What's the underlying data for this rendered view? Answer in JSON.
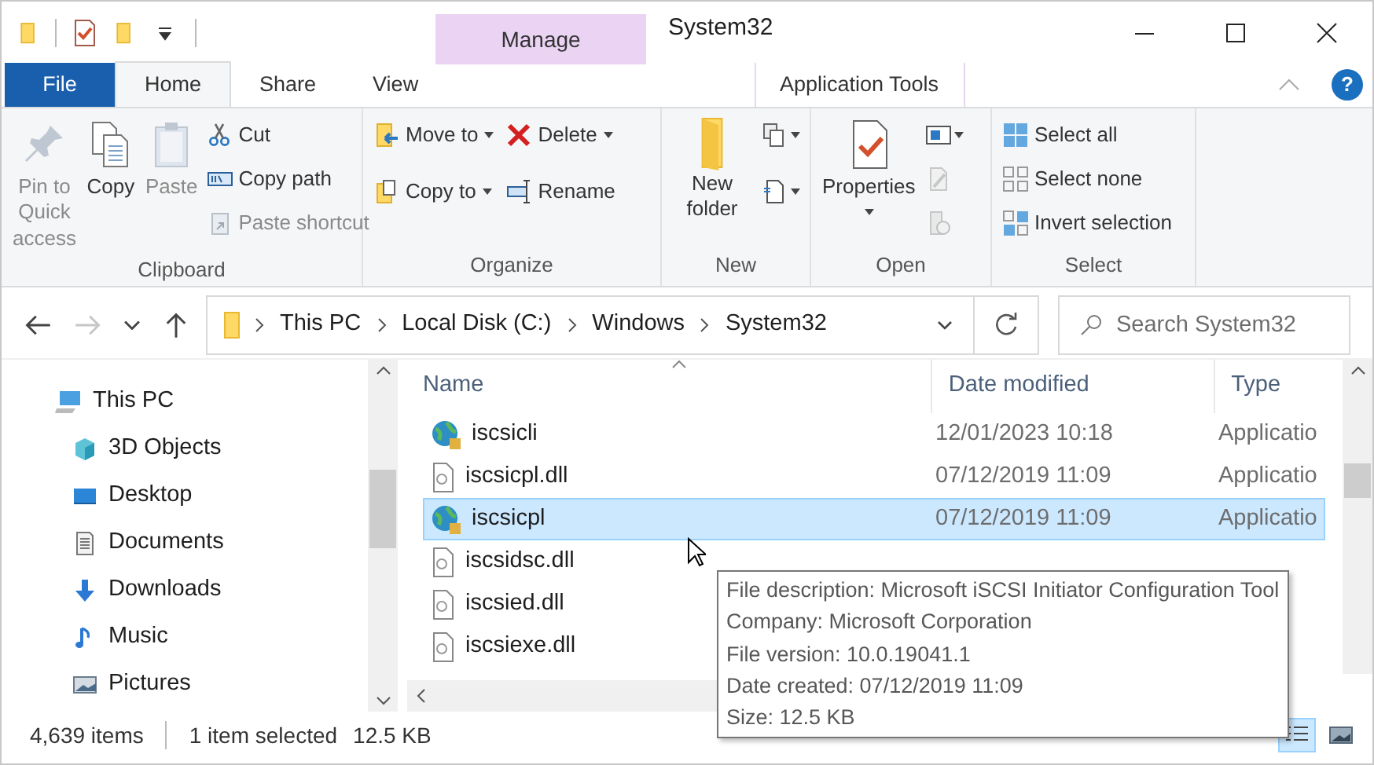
{
  "window": {
    "title": "System32",
    "contextual_header": "Manage"
  },
  "tabs": [
    {
      "label": "File",
      "kind": "file",
      "selected": false
    },
    {
      "label": "Home",
      "kind": "normal",
      "selected": true
    },
    {
      "label": "Share",
      "kind": "normal",
      "selected": false
    },
    {
      "label": "View",
      "kind": "normal",
      "selected": false
    },
    {
      "label": "Application Tools",
      "kind": "contextual",
      "selected": false
    }
  ],
  "help_button": "?",
  "ribbon": [
    {
      "label": "Clipboard",
      "columns": [
        [
          {
            "kind": "large",
            "label": "Pin to Quick access",
            "disabled": true,
            "dropdown": false
          }
        ],
        [
          {
            "kind": "large",
            "label": "Copy",
            "disabled": false,
            "dropdown": false
          }
        ],
        [
          {
            "kind": "large",
            "label": "Paste",
            "disabled": true,
            "dropdown": false
          }
        ],
        [
          {
            "kind": "small",
            "label": "Cut",
            "disabled": false,
            "dropdown": false
          },
          {
            "kind": "small",
            "label": "Copy path",
            "disabled": false,
            "dropdown": false
          },
          {
            "kind": "small",
            "label": "Paste shortcut",
            "disabled": true,
            "dropdown": false
          }
        ]
      ]
    },
    {
      "label": "Organize",
      "columns": [
        [
          {
            "kind": "small",
            "label": "Move to",
            "disabled": false,
            "dropdown": true
          },
          {
            "kind": "small",
            "label": "Copy to",
            "disabled": false,
            "dropdown": true
          }
        ],
        [
          {
            "kind": "small",
            "label": "Delete",
            "disabled": false,
            "dropdown": true
          },
          {
            "kind": "small",
            "label": "Rename",
            "disabled": false,
            "dropdown": false
          }
        ]
      ]
    },
    {
      "label": "New",
      "columns": [
        [
          {
            "kind": "large",
            "label": "New folder",
            "disabled": false,
            "dropdown": false
          }
        ],
        [
          {
            "kind": "icon",
            "disabled": false,
            "dropdown": true
          },
          {
            "kind": "icon",
            "disabled": false,
            "dropdown": true
          }
        ]
      ]
    },
    {
      "label": "Open",
      "columns": [
        [
          {
            "kind": "large",
            "label": "Properties",
            "disabled": false,
            "dropdown": true
          }
        ],
        [
          {
            "kind": "icon",
            "disabled": false,
            "dropdown": true
          },
          {
            "kind": "icon",
            "disabled": true,
            "dropdown": false
          },
          {
            "kind": "icon",
            "disabled": true,
            "dropdown": false
          }
        ]
      ]
    },
    {
      "label": "Select",
      "columns": [
        [
          {
            "kind": "small",
            "label": "Select all",
            "disabled": false,
            "dropdown": false
          },
          {
            "kind": "small",
            "label": "Select none",
            "disabled": false,
            "dropdown": false
          },
          {
            "kind": "small",
            "label": "Invert selection",
            "disabled": false,
            "dropdown": false
          }
        ]
      ]
    }
  ],
  "navigation": {
    "forward_disabled": true,
    "breadcrumb": [
      "This PC",
      "Local Disk (C:)",
      "Windows",
      "System32"
    ],
    "search": {
      "placeholder": "Search System32"
    }
  },
  "sidebar": {
    "items": [
      {
        "label": "This PC",
        "children": [
          {
            "label": "3D Objects"
          },
          {
            "label": "Desktop"
          },
          {
            "label": "Documents"
          },
          {
            "label": "Downloads"
          },
          {
            "label": "Music"
          },
          {
            "label": "Pictures"
          }
        ]
      }
    ]
  },
  "table": {
    "columns": [
      {
        "label": "Name",
        "sorted": true
      },
      {
        "label": "Date modified",
        "sorted": false
      },
      {
        "label": "Type",
        "sorted": false
      }
    ],
    "rows": [
      {
        "kind": "app",
        "name": "iscsicli",
        "date": "12/01/2023 10:18",
        "type": "Applicatio",
        "selected": false
      },
      {
        "kind": "dll",
        "name": "iscsicpl.dll",
        "date": "07/12/2019 11:09",
        "type": "Applicatio",
        "selected": false
      },
      {
        "kind": "app",
        "name": "iscsicpl",
        "date": "07/12/2019 11:09",
        "type": "Applicatio",
        "selected": true
      },
      {
        "kind": "dll",
        "name": "iscsidsc.dll",
        "selected": false
      },
      {
        "kind": "dll",
        "name": "iscsied.dll",
        "selected": false
      },
      {
        "kind": "dll",
        "name": "iscsiexe.dll",
        "selected": false
      }
    ]
  },
  "tooltip": [
    "File description: Microsoft iSCSI Initiator Configuration Tool",
    "Company: Microsoft Corporation",
    "File version: 10.0.19041.1",
    "Date created: 07/12/2019 11:09",
    "Size: 12.5 KB"
  ],
  "status_bar": {
    "item_count": "4,639 items",
    "selection": "1 item selected",
    "size": "12.5 KB",
    "views": [
      {
        "kind": "details",
        "selected": true
      },
      {
        "kind": "large_icons",
        "selected": false
      }
    ]
  }
}
